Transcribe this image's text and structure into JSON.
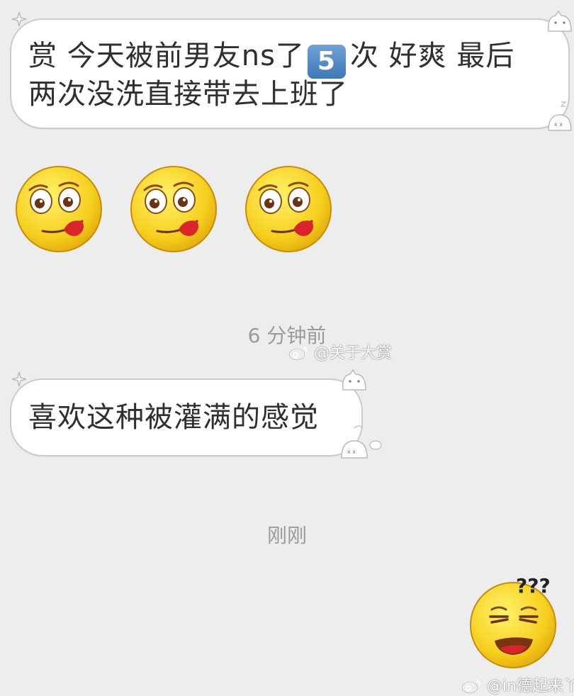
{
  "messages": [
    {
      "line1_before": "赏 今天被前男友ns了",
      "badge": "5",
      "line1_after": "次 好爽 最后",
      "line2": "两次没洗直接带去上班了"
    },
    {
      "text": "喜欢这种被灌满的感觉"
    }
  ],
  "timestamps": [
    "6 分钟前",
    "刚刚"
  ],
  "watermarks": [
    "@关于大赏",
    "@in德起来丫"
  ],
  "emojis": {
    "tongue_face_icon": "yum-face-icon",
    "reply_icon": "squint-grin-question-icon",
    "reply_marks": "???"
  },
  "colors": {
    "background": "#ededed",
    "bubble": "#ffffff",
    "bubble_border": "#c9cbd3",
    "emoji_yellow": "#f6cf1f",
    "tongue": "#d9242b"
  }
}
